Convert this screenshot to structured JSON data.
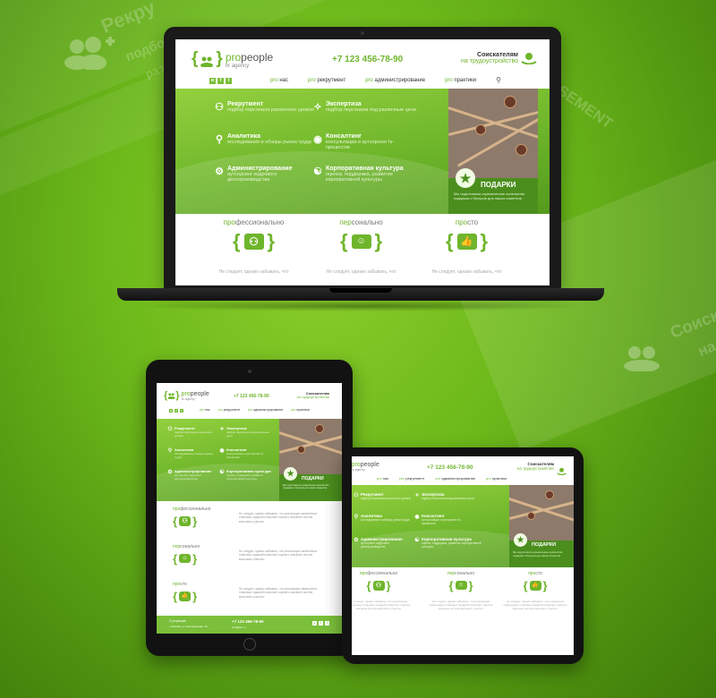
{
  "background": {
    "word1": "Рекру",
    "word2": "подбор пер",
    "word3": "различного у",
    "word4": "SEMENT",
    "word5": "Соиск",
    "word6": "на"
  },
  "site": {
    "logo_pro": "pro",
    "logo_people": "people",
    "logo_sub": "hr agency",
    "phone": "+7 123 456-78-90",
    "seekers_line1": "Соискателям",
    "seekers_line2": "на трудоустройство",
    "social": [
      "в",
      "f",
      "t"
    ],
    "nav": [
      {
        "pro": "pro",
        "rest": " нас"
      },
      {
        "pro": "pro",
        "rest": " рекрутмент"
      },
      {
        "pro": "pro",
        "rest": " администрирование"
      },
      {
        "pro": "pro",
        "rest": " практики"
      }
    ],
    "services": [
      {
        "title": "Рекрутмент",
        "desc": "подбор персонала различного уровня"
      },
      {
        "title": "Экспертиза",
        "desc": "подбор персонала под различные цели"
      },
      {
        "title": "Аналитика",
        "desc": "исследования и обзоры рынка труда"
      },
      {
        "title": "Консалтинг",
        "desc": "консультации и аутсорсинг hr-процессов"
      },
      {
        "title": "Администрирование",
        "desc": "аутсорсинг кадрового делопроизводства"
      },
      {
        "title": "Корпоративная культура",
        "desc": "оценка, поддержка, развитие корпоративной культуры"
      }
    ],
    "gift_title": "ПОДАРКИ",
    "gift_desc": "Мы подготовили ограниченное количество подарков и бонусов для наших клиентов",
    "features": [
      {
        "pro": "про",
        "rest": "фессионально"
      },
      {
        "pro": "пер",
        "rest": "сонально"
      },
      {
        "pro": "про",
        "rest": "сто"
      }
    ],
    "feature_text": "Не следует, однако забывать, что",
    "feature_long": "Не следует, однако забывать, что реализация намеченных плановых заданий позволяет оценить значение систем массового участия.",
    "footer_left": "© propeople",
    "footer_sub": "г. Москва, ул. Центральная, 10",
    "footer_phone": "+7 123 456-78-90",
    "footer_mail": "info@pro.ru"
  },
  "colors": {
    "accent": "#6fb52c",
    "bg": "#5fa818",
    "device": "#121212"
  }
}
